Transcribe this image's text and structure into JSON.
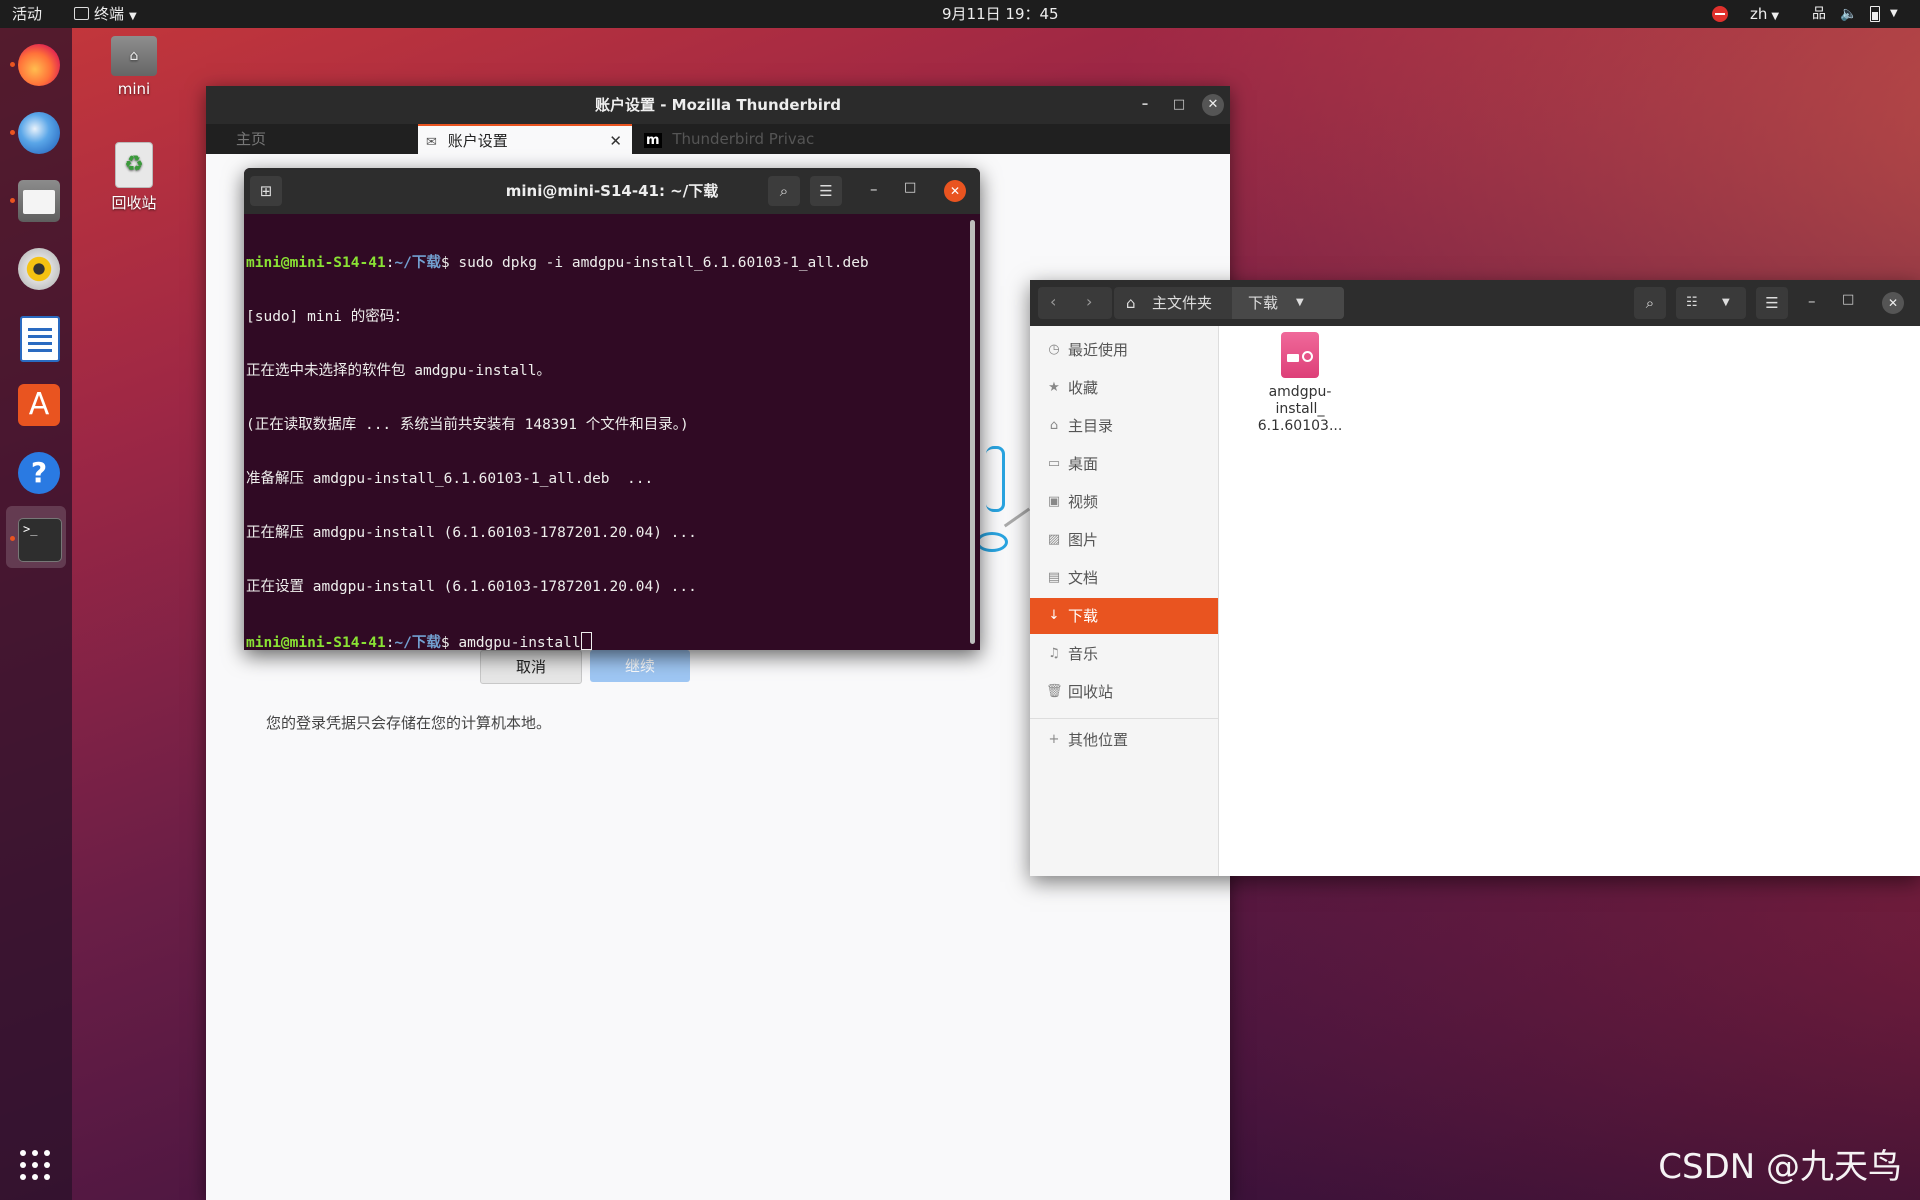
{
  "topbar": {
    "activities": "活动",
    "app_menu": "终端",
    "clock": "9月11日  19：45",
    "lang": "zh"
  },
  "desktop": {
    "home_label": "mini",
    "trash_label": "回收站"
  },
  "thunderbird": {
    "title": "账户设置 - Mozilla Thunderbird",
    "tab_home": "主页",
    "tab_account": "账户设置",
    "tab_privacy": "Thunderbird Privac",
    "cancel": "取消",
    "continue": "继续",
    "note": "您的登录凭据只会存储在您的计算机本地。"
  },
  "terminal": {
    "title": "mini@mini-S14-41: ~/下载",
    "prompt_user": "mini@mini-S14-41",
    "prompt_sep": ":",
    "prompt_path": "~/下载",
    "prompt_dollar": "$ ",
    "cmd1": "sudo dpkg -i amdgpu-install_6.1.60103-1_all.deb",
    "out1": "[sudo] mini 的密码：",
    "out2": "正在选中未选择的软件包 amdgpu-install。",
    "out3": "(正在读取数据库 ... 系统当前共安装有 148391 个文件和目录。)",
    "out4": "准备解压 amdgpu-install_6.1.60103-1_all.deb  ...",
    "out5": "正在解压 amdgpu-install (6.1.60103-1787201.20.04) ...",
    "out6": "正在设置 amdgpu-install (6.1.60103-1787201.20.04) ...",
    "cmd2": "amdgpu-install"
  },
  "files": {
    "crumb_home": "主文件夹",
    "crumb_current": "下载",
    "sidebar": [
      {
        "label": "最近使用",
        "icon": "clock-icon"
      },
      {
        "label": "收藏",
        "icon": "star-icon"
      },
      {
        "label": "主目录",
        "icon": "home-icon"
      },
      {
        "label": "桌面",
        "icon": "desktop-icon"
      },
      {
        "label": "视频",
        "icon": "video-icon"
      },
      {
        "label": "图片",
        "icon": "picture-icon"
      },
      {
        "label": "文档",
        "icon": "document-icon"
      },
      {
        "label": "下载",
        "icon": "download-icon"
      },
      {
        "label": "音乐",
        "icon": "music-icon"
      },
      {
        "label": "回收站",
        "icon": "trash-icon"
      },
      {
        "label": "其他位置",
        "icon": "plus-icon"
      }
    ],
    "file_line1": "amdgpu-",
    "file_line2": "install_",
    "file_line3": "6.1.60103..."
  },
  "watermark": "CSDN @九天鸟",
  "colors": {
    "accent": "#e95420",
    "terminal_bg": "#300a24",
    "prompt_user": "#8ae234",
    "prompt_path": "#729fcf"
  }
}
